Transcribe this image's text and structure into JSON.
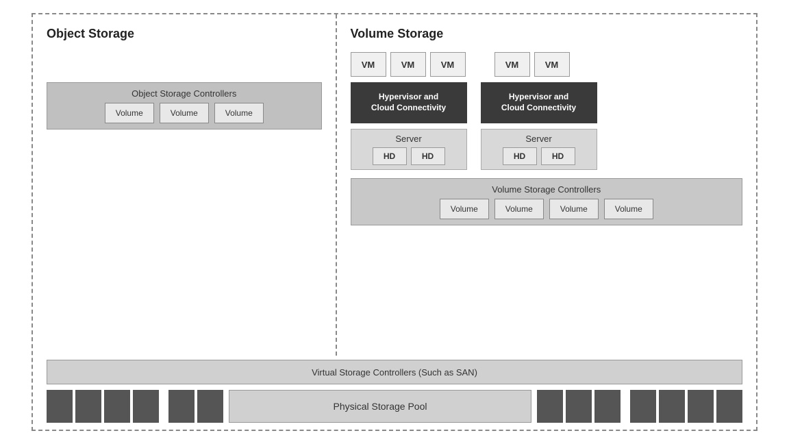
{
  "diagram": {
    "title_object": "Object Storage",
    "title_volume": "Volume Storage",
    "vm_label": "VM",
    "hd_label": "HD",
    "volume_label": "Volume",
    "hypervisor_label": "Hypervisor and\nCloud Connectivity",
    "server_label": "Server",
    "obj_controllers_title": "Object Storage Controllers",
    "vol_controllers_title": "Volume Storage Controllers",
    "virtual_controllers_label": "Virtual Storage Controllers (Such as SAN)",
    "physical_pool_label": "Physical Storage Pool",
    "vm_groups": [
      {
        "vms": [
          "VM",
          "VM",
          "VM"
        ]
      },
      {
        "vms": [
          "VM",
          "VM"
        ]
      }
    ],
    "hd_groups": [
      {
        "hds": [
          "HD",
          "HD"
        ]
      },
      {
        "hds": [
          "HD",
          "HD"
        ]
      }
    ],
    "obj_volumes": [
      "Volume",
      "Volume",
      "Volume"
    ],
    "vol_volumes": [
      "Volume",
      "Volume",
      "Volume",
      "Volume"
    ]
  }
}
